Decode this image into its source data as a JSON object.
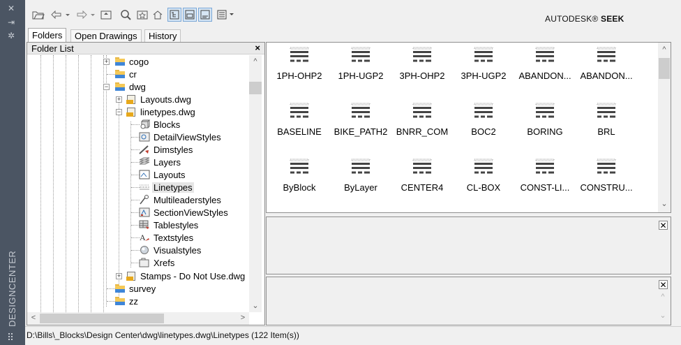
{
  "palette": {
    "strip": "#4b5563",
    "accent_blue": "#3f86d8",
    "folder_yellow": "#f5c957"
  },
  "sidebar": {
    "title": "DESIGNCENTER"
  },
  "toolbar": {
    "brand_name": "AUTODESK",
    "brand_mark": "®",
    "brand_product": "SEEK"
  },
  "tabs": [
    {
      "label": "Folders"
    },
    {
      "label": "Open Drawings"
    },
    {
      "label": "History"
    }
  ],
  "folder_panel": {
    "title": "Folder List",
    "close": "×",
    "tree": {
      "cogo": "cogo",
      "cr": "cr",
      "dwg": "dwg",
      "layouts_dwg": "Layouts.dwg",
      "linetypes_dwg": "linetypes.dwg",
      "children": [
        "Blocks",
        "DetailViewStyles",
        "Dimstyles",
        "Layers",
        "Layouts",
        "Linetypes",
        "Multileaderstyles",
        "SectionViewStyles",
        "Tablestyles",
        "Textstyles",
        "Visualstyles",
        "Xrefs"
      ],
      "stamps": "Stamps - Do Not Use.dwg",
      "survey": "survey",
      "zz": "zz"
    }
  },
  "content": {
    "items": [
      "1PH-OHP2",
      "1PH-UGP2",
      "3PH-OHP2",
      "3PH-UGP2",
      "ABANDON...",
      "ABANDON...",
      "BASELINE",
      "BIKE_PATH2",
      "BNRR_COM",
      "BOC2",
      "BORING",
      "BRL",
      "ByBlock",
      "ByLayer",
      "CENTER4",
      "CL-BOX",
      "CONST-LI...",
      "CONSTRU..."
    ]
  },
  "status": {
    "path": "D:\\Bills\\_Blocks\\Design Center\\dwg\\linetypes.dwg\\Linetypes (122 Item(s))"
  }
}
